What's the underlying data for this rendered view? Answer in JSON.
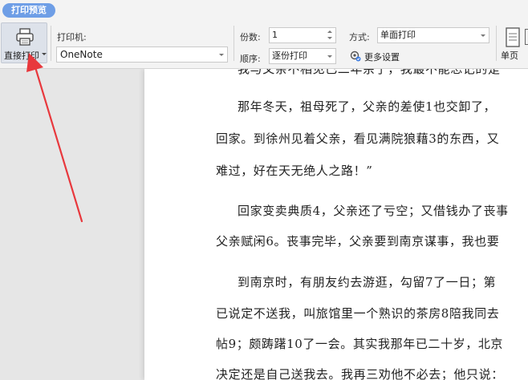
{
  "header": {
    "title": "打印预览"
  },
  "toolbar": {
    "print_button_label": "直接打印",
    "printer_label": "打印机:",
    "printer_value": "OneNote",
    "copies_label": "份数:",
    "copies_value": "1",
    "order_label": "顺序:",
    "order_value": "逐份打印",
    "mode_label": "方式:",
    "mode_value": "单面打印",
    "more_settings_label": "更多设置",
    "single_page_label": "单页"
  },
  "document": {
    "lines": [
      "我与父亲不相见已二年余了，我最不能忘记的是",
      "那年冬天，祖母死了，父亲的差使1也交卸了，",
      "回家。到徐州见着父亲，看见满院狼藉3的东西，又",
      "难过，好在天无绝人之路！”",
      "回家变卖典质4，父亲还了亏空；又借钱办了丧事",
      "父亲赋闲6。丧事完毕，父亲要到南京谋事，我也要",
      "到南京时，有朋友约去游逛，勾留7了一日；第",
      "已说定不送我，叫旅馆里一个熟识的茶房8陪我同去",
      "帖9；颇踌躇10了一会。其实我那年已二十岁，北京",
      "决定还是自己送我去。我再三劝他不必去；他只说："
    ]
  },
  "colors": {
    "title_pill": "#6e9ee6",
    "annotation_arrow": "#e8383d"
  },
  "icons": {
    "print": "printer-icon",
    "more_settings": "gear-icon",
    "single_page": "page-icon"
  }
}
